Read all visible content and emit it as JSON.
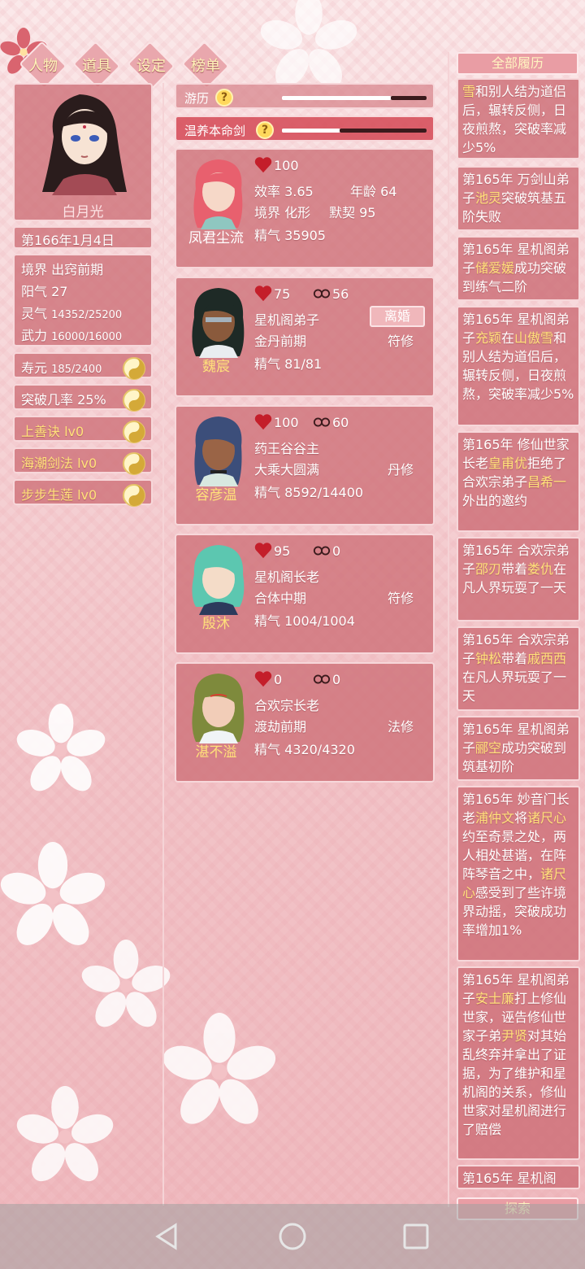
{
  "nav": {
    "tabs": [
      {
        "label": "人物"
      },
      {
        "label": "道具"
      },
      {
        "label": "设定"
      },
      {
        "label": "榜单"
      }
    ]
  },
  "character": {
    "name": "白月光",
    "date": "第166年1月4日",
    "realm_label": "境界",
    "realm": "出窍前期",
    "yang_label": "阳气",
    "yang": "27",
    "ling_label": "灵气",
    "ling": "14352/25200",
    "wuli_label": "武力",
    "wuli": "16000/16000",
    "shouyuan_label": "寿元",
    "shouyuan": "185/2400",
    "tupo_label": "突破几率",
    "tupo": "25%",
    "skills": [
      {
        "label": "上善诀 lv0"
      },
      {
        "label": "海潮剑法 lv0"
      },
      {
        "label": "步步生莲 lv0"
      }
    ]
  },
  "bars": [
    {
      "label": "游历",
      "progress": 0.75
    },
    {
      "label": "温养本命剑",
      "progress": 0.4
    }
  ],
  "cards": [
    {
      "name": "凤君尘流",
      "hearts": "100",
      "line1_a": "效率 3.65",
      "line1_b": "年龄 64",
      "line2_a": "境界 化形",
      "line2_b": "默契 95",
      "line3": "精气 35905"
    },
    {
      "name": "魏宸",
      "hearts": "75",
      "bond": "56",
      "line1": "星机阁弟子",
      "line2": "金丹前期",
      "line2_r": "符修",
      "line3": "精气 81/81",
      "button": "离婚"
    },
    {
      "name": "容彦温",
      "hearts": "100",
      "bond": "60",
      "line1": "药王谷谷主",
      "line2": "大乘大圆满",
      "line2_r": "丹修",
      "line3": "精气 8592/14400"
    },
    {
      "name": "殷沐",
      "hearts": "95",
      "bond": "0",
      "line1": "星机阁长老",
      "line2": "合体中期",
      "line2_r": "符修",
      "line3": "精气 1004/1004"
    },
    {
      "name": "湛不溢",
      "hearts": "0",
      "bond": "0",
      "line1": "合欢宗长老",
      "line2": "渡劫前期",
      "line2_r": "法修",
      "line3": "精气 4320/4320"
    }
  ],
  "history": {
    "header": "全部履历",
    "footer": "探索",
    "items": [
      {
        "segments": [
          [
            "雪",
            1
          ],
          [
            "和别人结为道侣后，辗转反侧，日夜煎熬，突破率减少5%",
            0
          ]
        ]
      },
      {
        "segments": [
          [
            "第165年 万剑山弟子",
            0
          ],
          [
            "池灵",
            1
          ],
          [
            "突破筑基五阶失败",
            0
          ]
        ]
      },
      {
        "segments": [
          [
            "第165年 星机阁弟子",
            0
          ],
          [
            "储爱媛",
            1
          ],
          [
            "成功突破到练气二阶",
            0
          ]
        ]
      },
      {
        "segments": [
          [
            "第165年 星机阁弟子",
            0
          ],
          [
            "充颖",
            1
          ],
          [
            "在",
            0
          ],
          [
            "山傲雪",
            1
          ],
          [
            "和别人结为道侣后，辗转反侧，日夜煎熬，突破率减少5%",
            0
          ]
        ]
      },
      {
        "segments": [
          [
            "第165年 修仙世家长老",
            0
          ],
          [
            "皇甫优",
            1
          ],
          [
            "拒绝了合欢宗弟子",
            0
          ],
          [
            "昌希一",
            1
          ],
          [
            "外出的邀约",
            0
          ]
        ]
      },
      {
        "segments": [
          [
            "第165年 合欢宗弟子",
            0
          ],
          [
            "邵刃",
            1
          ],
          [
            "带着",
            0
          ],
          [
            "娄仇",
            1
          ],
          [
            "在凡人界玩耍了一天",
            0
          ]
        ]
      },
      {
        "segments": [
          [
            "第165年 合欢宗弟子",
            0
          ],
          [
            "钟松",
            1
          ],
          [
            "带着",
            0
          ],
          [
            "戚西西",
            1
          ],
          [
            "在凡人界玩耍了一天",
            0
          ]
        ]
      },
      {
        "segments": [
          [
            "第165年 星机阁弟子",
            0
          ],
          [
            "郦空",
            1
          ],
          [
            "成功突破到筑基初阶",
            0
          ]
        ]
      },
      {
        "segments": [
          [
            "第165年 妙音门长老",
            0
          ],
          [
            "浦仲文",
            1
          ],
          [
            "将",
            0
          ],
          [
            "诸尺心",
            1
          ],
          [
            "约至奇景之处，两人相处甚谐，在阵阵琴音之中，",
            0
          ],
          [
            "诸尺心",
            1
          ],
          [
            "感受到了些许境界动摇，突破成功率增加1%",
            0
          ]
        ]
      },
      {
        "segments": [
          [
            "第165年 星机阁弟子",
            0
          ],
          [
            "安士廉",
            1
          ],
          [
            "打上修仙世家，诬告修仙世家子弟",
            0
          ],
          [
            "尹贤",
            1
          ],
          [
            "对其始乱终弃并拿出了证据，为了维护和星机阁的关系，修仙世家对星机阁进行了赔偿",
            0
          ]
        ]
      },
      {
        "segments": [
          [
            "第165年 星机阁",
            0
          ]
        ]
      }
    ]
  }
}
